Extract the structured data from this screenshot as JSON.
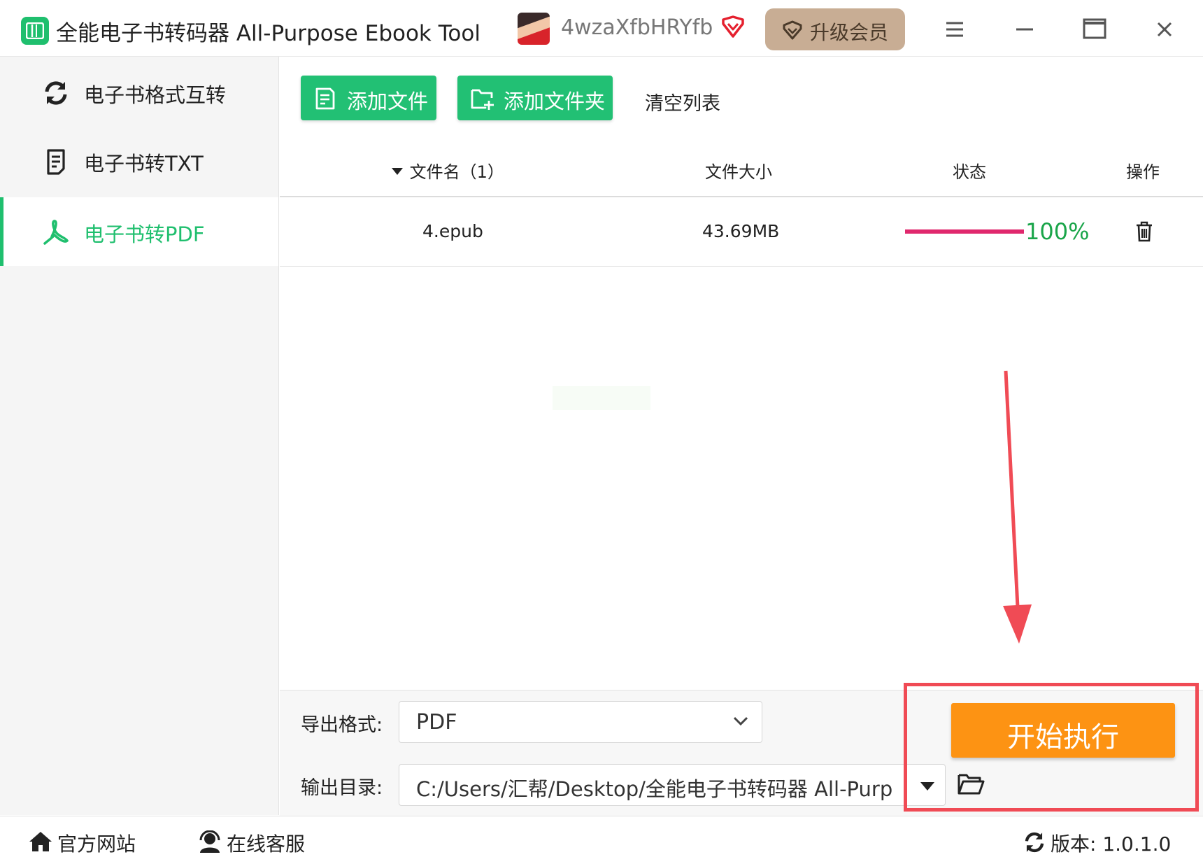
{
  "titlebar": {
    "app_title": "全能电子书转码器 All-Purpose Ebook Tool",
    "username": "4wzaXfbHRYfb",
    "upgrade_label": "升级会员"
  },
  "sidebar": {
    "items": [
      {
        "label": "电子书格式互转",
        "icon": "refresh-icon",
        "active": false
      },
      {
        "label": "电子书转TXT",
        "icon": "document-icon",
        "active": false
      },
      {
        "label": "电子书转PDF",
        "icon": "pdf-icon",
        "active": true
      }
    ]
  },
  "toolbar": {
    "add_file_label": "添加文件",
    "add_folder_label": "添加文件夹",
    "clear_list_label": "清空列表"
  },
  "table": {
    "headers": {
      "filename": "文件名（1）",
      "size": "文件大小",
      "status": "状态",
      "action": "操作"
    },
    "rows": [
      {
        "filename": "4.epub",
        "size": "43.69MB",
        "progress": 1.0,
        "progress_text": "100%"
      }
    ]
  },
  "output": {
    "format_label": "导出格式:",
    "format_value": "PDF",
    "dir_label": "输出目录:",
    "dir_value": "C:/Users/汇帮/Desktop/全能电子书转码器 All-Purpose Ebook Tool",
    "start_label": "开始执行"
  },
  "footer": {
    "website_label": "官方网站",
    "support_label": "在线客服",
    "version_label": "版本: 1.0.1.0"
  },
  "colors": {
    "accent_green": "#1fbf6e",
    "progress_pink": "#e0286d",
    "progress_text_green": "#1aa54a",
    "start_orange": "#fd9313",
    "annotation_red": "#f04b55"
  }
}
